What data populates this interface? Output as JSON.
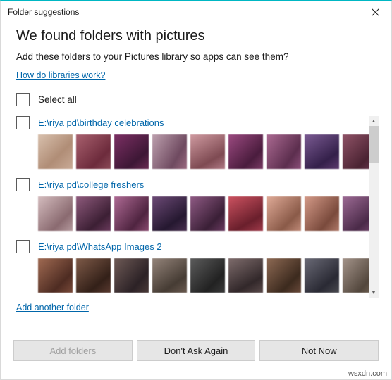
{
  "window": {
    "title": "Folder suggestions",
    "close_icon": "close-icon",
    "accent_color": "#00b7c3"
  },
  "content": {
    "headline": "We found folders with pictures",
    "subtext": "Add these folders to your Pictures library so apps can see them?",
    "help_link": "How do libraries work?",
    "select_all_label": "Select all",
    "add_another_label": "Add another folder",
    "link_color": "#0066aa"
  },
  "folders": [
    {
      "path": "E:\\riya pd\\birthday celebrations",
      "checked": false,
      "thumbs": [
        "#c9aa96",
        "#8b4a58",
        "#6a2b52",
        "#9b6a80",
        "#b07a86",
        "#7a3a64",
        "#8c4f7a",
        "#5c3a6e",
        "#6d3a52",
        "#a54a5a"
      ]
    },
    {
      "path": "E:\\riya pd\\college freshers",
      "checked": false,
      "thumbs": [
        "#b59a9e",
        "#6a3a5c",
        "#8a4a70",
        "#4a3050",
        "#6a3a60",
        "#a03a4a",
        "#c08a78",
        "#b07a6a",
        "#7a4a72",
        "#a06a90"
      ]
    },
    {
      "path": "E:\\riya pd\\WhatsApp Images 2",
      "checked": false,
      "thumbs": [
        "#7a4a3a",
        "#5a3a30",
        "#4a3a38",
        "#6a5a50",
        "#3a3a3a",
        "#5a4a4a",
        "#6a4a3a",
        "#4a4a50",
        "#7a6a5a",
        "#3a3038"
      ]
    }
  ],
  "scrollbar": {
    "up_arrow": "▲",
    "down_arrow": "▼"
  },
  "buttons": [
    {
      "label": "Add folders",
      "disabled": true
    },
    {
      "label": "Don't Ask Again",
      "disabled": false
    },
    {
      "label": "Not Now",
      "disabled": false
    }
  ],
  "watermark": "wsxdn.com"
}
